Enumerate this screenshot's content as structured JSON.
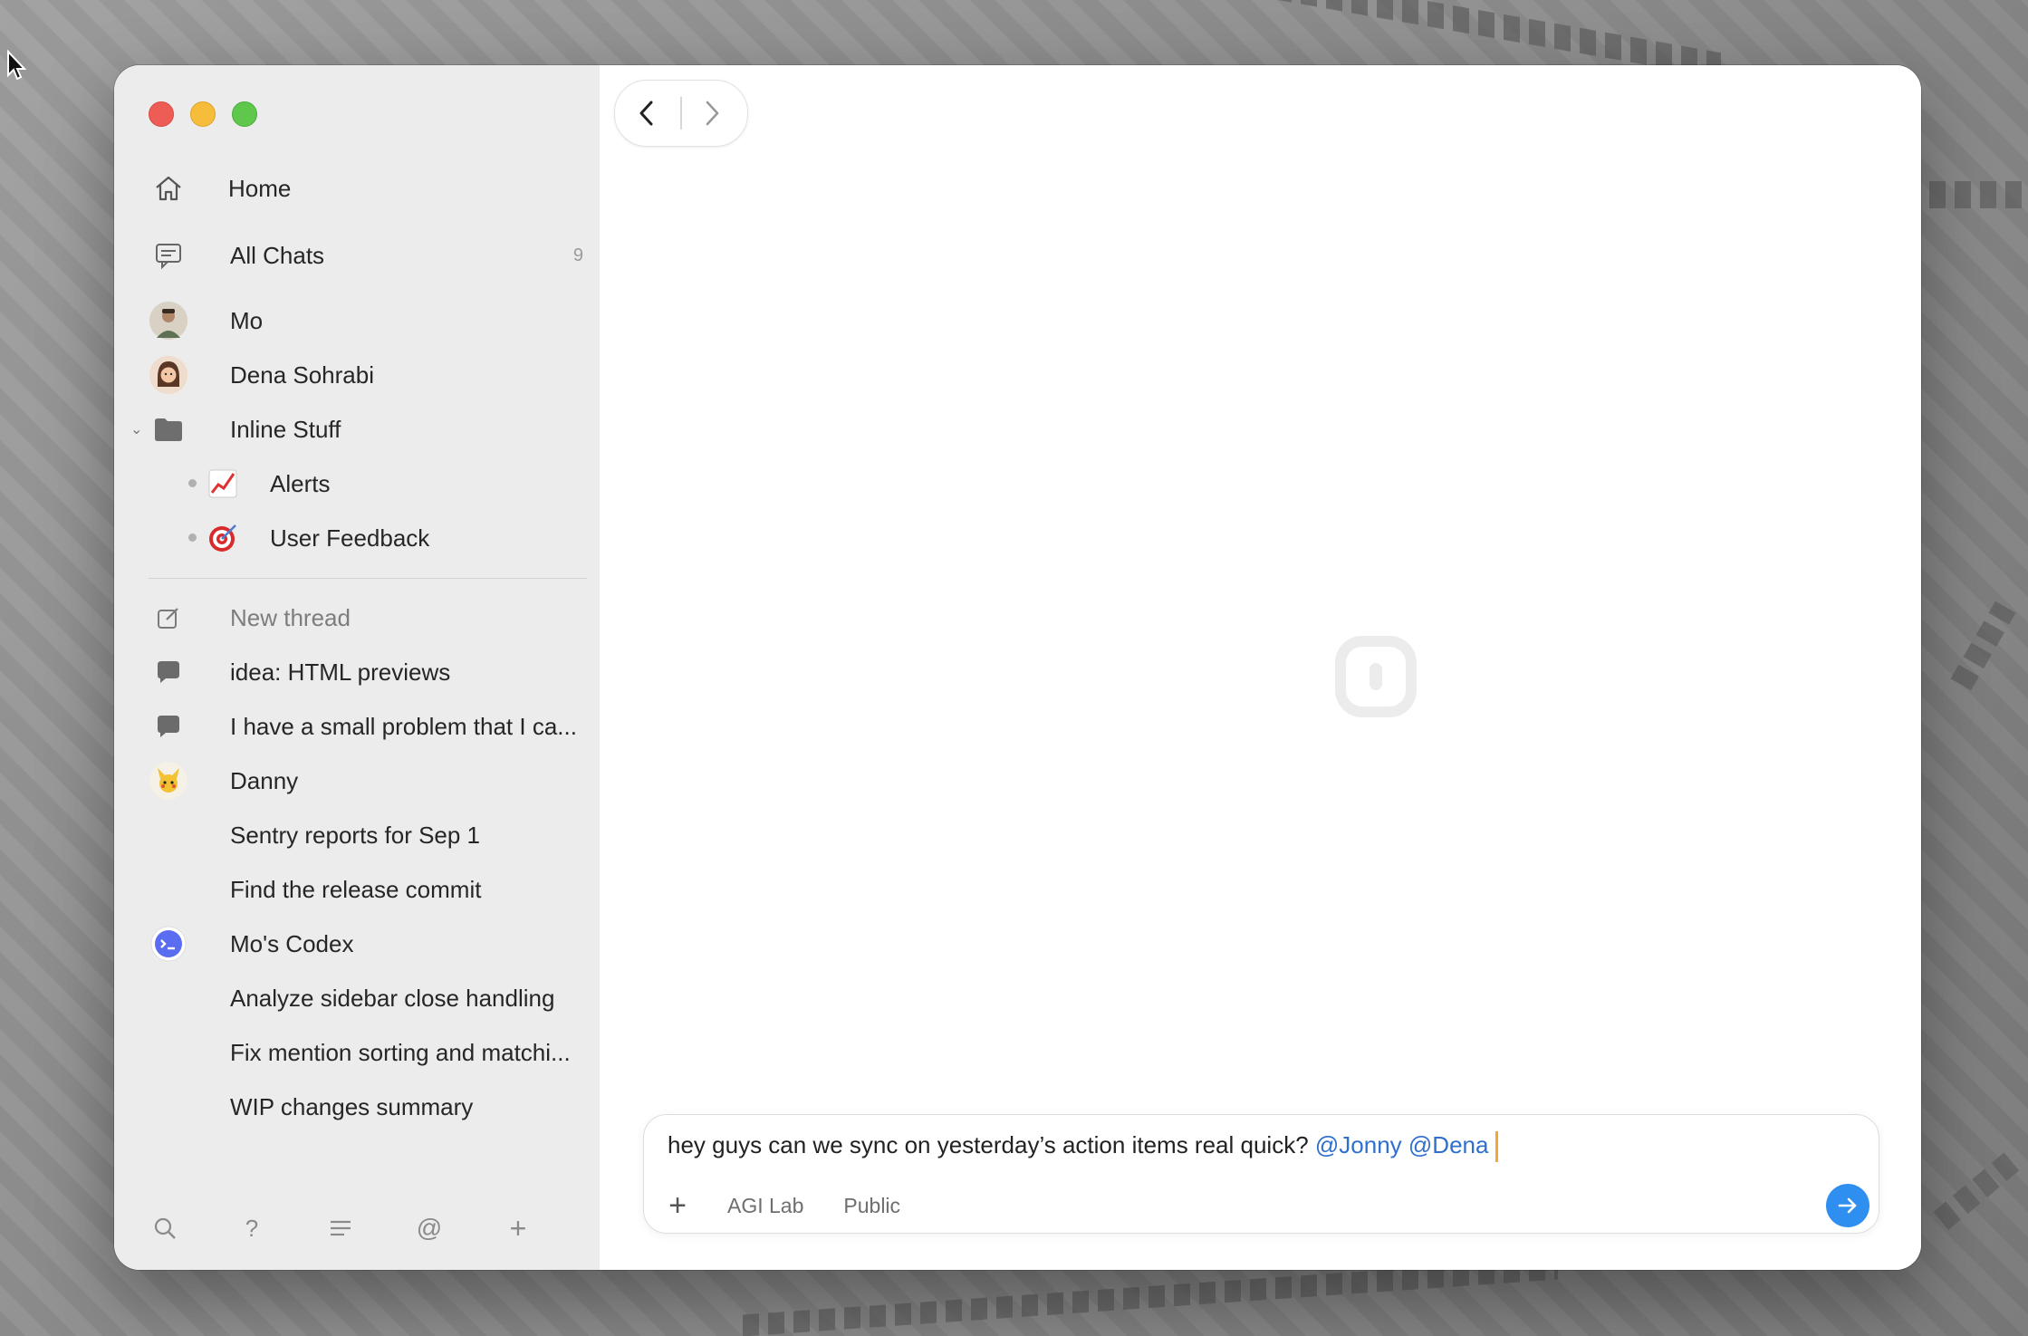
{
  "sidebar": {
    "home": "Home",
    "all_chats": {
      "label": "All Chats",
      "count": "9"
    },
    "people": [
      {
        "name": "Mo",
        "avatar": "person-avatar-mo"
      },
      {
        "name": "Dena Sohrabi",
        "avatar": "person-avatar-dena"
      }
    ],
    "folder": {
      "label": "Inline Stuff",
      "items": [
        {
          "label": "Alerts",
          "icon": "chart-increasing-icon"
        },
        {
          "label": "User Feedback",
          "icon": "direct-hit-icon"
        }
      ]
    },
    "new_thread": "New thread",
    "threads": [
      "idea: HTML previews",
      "I have a small problem that I ca...",
      "Danny",
      "Sentry reports for Sep 1",
      "Find the release commit",
      "Mo's Codex",
      "Analyze sidebar close handling",
      "Fix mention sorting and matchi...",
      "WIP changes summary"
    ]
  },
  "composer": {
    "text": "hey guys can we sync on yesterday’s action items real quick?",
    "mentions": [
      "@Jonny",
      "@Dena"
    ],
    "space": "AGI Lab",
    "visibility": "Public"
  },
  "colors": {
    "accent": "#2f8ff0",
    "mention": "#2f6fce",
    "caret": "#f3a92e"
  }
}
